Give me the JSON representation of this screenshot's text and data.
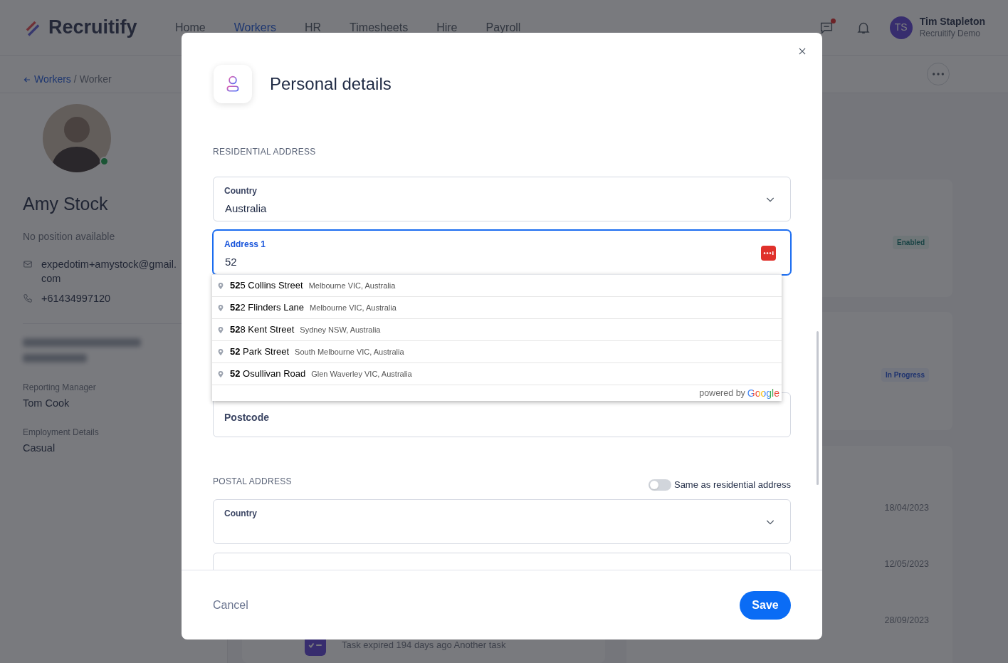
{
  "app": {
    "logo": "Recruitify",
    "nav": [
      {
        "label": "Home",
        "selected": false
      },
      {
        "label": "Workers",
        "selected": true
      },
      {
        "label": "HR",
        "selected": false
      },
      {
        "label": "Timesheets",
        "selected": false
      },
      {
        "label": "Hire",
        "selected": false
      },
      {
        "label": "Payroll",
        "selected": false
      }
    ],
    "chat_unread": true,
    "user": {
      "initials": "TS",
      "name": "Tim Stapleton",
      "org": "Recruitify Demo"
    }
  },
  "breadcrumb": {
    "parent": "Workers",
    "separator": "/",
    "current": "Worker"
  },
  "profile": {
    "name": "Amy Stock",
    "position": "No position available",
    "online": true,
    "email": "expedotim+amystock@gmail.com",
    "phone": "+61434997120",
    "details": [
      {
        "label": "Reporting Manager",
        "value": "Tom Cook"
      },
      {
        "label": "Employment Details",
        "value": "Casual"
      }
    ]
  },
  "cards": {
    "badges": [
      {
        "label": "Enabled",
        "kind": "success"
      },
      {
        "label": "In Progress",
        "kind": "info"
      }
    ],
    "dates": [
      "18/04/2023",
      "12/05/2023",
      "28/09/2023"
    ],
    "task": "Task expired 194 days ago Another task"
  },
  "modal": {
    "title": "Personal details",
    "residential": {
      "heading": "RESIDENTIAL ADDRESS",
      "country": {
        "label": "Country",
        "value": "Australia"
      },
      "address1": {
        "label": "Address 1",
        "value": "52",
        "focused": true
      },
      "postcode": {
        "label": "Postcode"
      }
    },
    "suggestions": [
      {
        "main": "**52**5 Collins Street",
        "secondary": "Melbourne VIC, Australia"
      },
      {
        "main": "**52**2 Flinders Lane",
        "secondary": "Melbourne VIC, Australia"
      },
      {
        "main": "**52**8 Kent Street",
        "secondary": "Sydney NSW, Australia"
      },
      {
        "main": "**52** Park Street",
        "secondary": "South Melbourne VIC, Australia"
      },
      {
        "main": "**52** Osullivan Road",
        "secondary": "Glen Waverley VIC, Australia"
      }
    ],
    "attribution_prefix": "powered by",
    "attribution_brand": "Google",
    "postal": {
      "heading": "POSTAL ADDRESS",
      "same_label": "Same as residential address",
      "same_on": false,
      "country": {
        "label": "Country"
      }
    },
    "cancel": "Cancel",
    "save": "Save"
  }
}
